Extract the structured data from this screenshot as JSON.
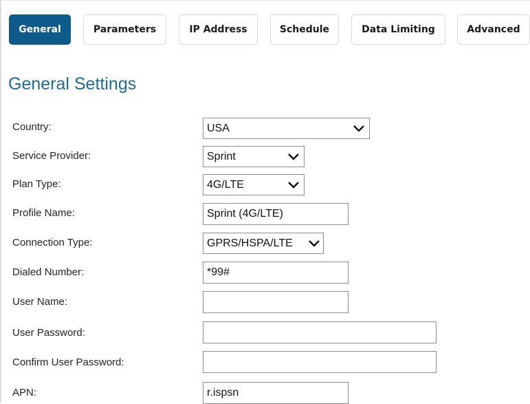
{
  "tabs": [
    {
      "label": "General",
      "active": true
    },
    {
      "label": "Parameters"
    },
    {
      "label": "IP Address"
    },
    {
      "label": "Schedule"
    },
    {
      "label": "Data Limiting"
    },
    {
      "label": "Advanced"
    }
  ],
  "title": "General Settings",
  "fields": {
    "country": {
      "label": "Country:",
      "value": "USA"
    },
    "service_provider": {
      "label": "Service Provider:",
      "value": "Sprint"
    },
    "plan_type": {
      "label": "Plan Type:",
      "value": "4G/LTE"
    },
    "profile_name": {
      "label": "Profile Name:",
      "value": "Sprint (4G/LTE)"
    },
    "connection_type": {
      "label": "Connection Type:",
      "value": "GPRS/HSPA/LTE"
    },
    "dialed_number": {
      "label": "Dialed Number:",
      "value": "*99#"
    },
    "user_name": {
      "label": "User Name:",
      "value": ""
    },
    "user_password": {
      "label": "User Password:",
      "value": ""
    },
    "confirm_password": {
      "label": "Confirm User Password:",
      "value": ""
    },
    "apn": {
      "label": "APN:",
      "value": "r.ispsn"
    }
  },
  "colors": {
    "accent": "#0e5a8a",
    "title": "#1e6b9a"
  },
  "icons": {
    "dropdown": "chevron-down-icon"
  }
}
